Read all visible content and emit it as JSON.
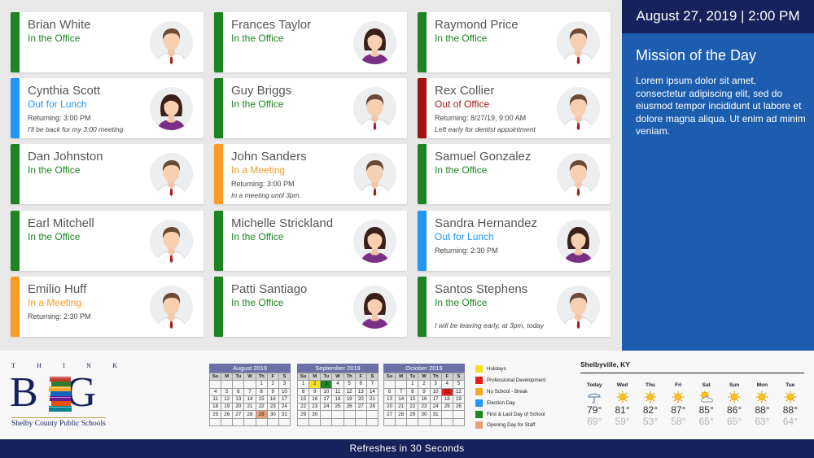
{
  "colors": {
    "in": "#1e8421",
    "lunch": "#2196f3",
    "meeting": "#fc9a28",
    "out": "#a01415",
    "navy": "#16225b",
    "panel": "#1c5daf"
  },
  "staff": [
    {
      "name": "Brian White",
      "status": "In the Office",
      "kind": "in",
      "gender": "m",
      "returning": "",
      "note": ""
    },
    {
      "name": "Cynthia Scott",
      "status": "Out for Lunch",
      "kind": "lunch",
      "gender": "f",
      "returning": "Returning: 3:00 PM",
      "note": "I'll be back for my 3:00 meeting"
    },
    {
      "name": "Dan Johnston",
      "status": "In the Office",
      "kind": "in",
      "gender": "m",
      "returning": "",
      "note": ""
    },
    {
      "name": "Earl Mitchell",
      "status": "In the Office",
      "kind": "in",
      "gender": "m",
      "returning": "",
      "note": ""
    },
    {
      "name": "Emilio Huff",
      "status": "In a Meeting",
      "kind": "meeting",
      "gender": "m",
      "returning": "Returning: 2:30 PM",
      "note": ""
    },
    {
      "name": "Frances Taylor",
      "status": "In the Office",
      "kind": "in",
      "gender": "f",
      "returning": "",
      "note": ""
    },
    {
      "name": "Guy Briggs",
      "status": "In the Office",
      "kind": "in",
      "gender": "m",
      "returning": "",
      "note": ""
    },
    {
      "name": "John Sanders",
      "status": "In a Meeting",
      "kind": "meeting",
      "gender": "m",
      "returning": "Returning: 3:00 PM",
      "note": "In a meeting until 3pm."
    },
    {
      "name": "Michelle Strickland",
      "status": "In the Office",
      "kind": "in",
      "gender": "f",
      "returning": "",
      "note": ""
    },
    {
      "name": "Patti Santiago",
      "status": "In the Office",
      "kind": "in",
      "gender": "f",
      "returning": "",
      "note": ""
    },
    {
      "name": "Raymond Price",
      "status": "In the Office",
      "kind": "in",
      "gender": "m",
      "returning": "",
      "note": ""
    },
    {
      "name": "Rex Collier",
      "status": "Out of Office",
      "kind": "out",
      "gender": "m",
      "returning": "Returning:  8/27/19, 9:00 AM",
      "note": "Left early for dentist appointment"
    },
    {
      "name": "Samuel Gonzalez",
      "status": "In the Office",
      "kind": "in",
      "gender": "m",
      "returning": "",
      "note": ""
    },
    {
      "name": "Sandra Hernandez",
      "status": "Out for Lunch",
      "kind": "lunch",
      "gender": "f",
      "returning": "Returning: 2:30 PM",
      "note": ""
    },
    {
      "name": "Santos Stephens",
      "status": "In the Office",
      "kind": "in",
      "gender": "m",
      "returning": "",
      "note": "I will be leaving early, at 3pm, today"
    }
  ],
  "header": {
    "datetime": "August 27, 2019 | 2:00 PM"
  },
  "mission": {
    "title": "Mission of the Day",
    "text": "Lorem ipsum dolor sit amet, consectetur adipiscing elit, sed do eiusmod tempor incididunt ut labore et dolore magna aliqua. Ut enim ad minim veniam."
  },
  "logo": {
    "think": [
      "T",
      "H",
      "I",
      "N",
      "K"
    ],
    "big_left": "B",
    "big_right": "G",
    "district": "Shelby County Public Schools"
  },
  "calendars": [
    {
      "title": "August 2019",
      "headers": [
        "Su",
        "M",
        "Tu",
        "W",
        "Th",
        "F",
        "S"
      ],
      "weeks": [
        [
          "",
          "",
          "",
          "",
          "1",
          "2",
          "3"
        ],
        [
          "4",
          "5",
          "6",
          "7",
          "8",
          "9",
          "10"
        ],
        [
          "11",
          "12",
          "13",
          "14",
          "15",
          "16",
          "17"
        ],
        [
          "18",
          "19",
          "20",
          "21",
          "22",
          "23",
          "24"
        ],
        [
          "25",
          "26",
          "27",
          "28",
          "29",
          "30",
          "31"
        ],
        [
          "",
          "",
          "",
          "",
          "",
          "",
          ""
        ]
      ],
      "highlights": [
        {
          "day": "29",
          "event": "Opening Day for Staff"
        }
      ]
    },
    {
      "title": "September 2019",
      "headers": [
        "Su",
        "M",
        "Tu",
        "W",
        "Th",
        "F",
        "S"
      ],
      "weeks": [
        [
          "1",
          "2",
          "3",
          "4",
          "5",
          "6",
          "7"
        ],
        [
          "8",
          "9",
          "10",
          "11",
          "12",
          "13",
          "14"
        ],
        [
          "15",
          "16",
          "17",
          "18",
          "19",
          "20",
          "21"
        ],
        [
          "22",
          "23",
          "24",
          "25",
          "26",
          "27",
          "28"
        ],
        [
          "29",
          "30",
          "",
          "",
          "",
          "",
          ""
        ],
        [
          "",
          "",
          "",
          "",
          "",
          "",
          ""
        ]
      ],
      "highlights": [
        {
          "day": "2",
          "event": "Holidays"
        },
        {
          "day": "3",
          "event": "First & Last Day of School"
        }
      ]
    },
    {
      "title": "October 2019",
      "headers": [
        "Su",
        "M",
        "Tu",
        "W",
        "Th",
        "F",
        "S"
      ],
      "weeks": [
        [
          "",
          "",
          "1",
          "2",
          "3",
          "4",
          "5"
        ],
        [
          "6",
          "7",
          "8",
          "9",
          "10",
          "11",
          "12"
        ],
        [
          "13",
          "14",
          "15",
          "16",
          "17",
          "18",
          "19"
        ],
        [
          "20",
          "21",
          "22",
          "23",
          "24",
          "25",
          "26"
        ],
        [
          "27",
          "28",
          "29",
          "30",
          "31",
          "",
          ""
        ],
        [
          "",
          "",
          "",
          "",
          "",
          "",
          ""
        ]
      ],
      "highlights": [
        {
          "day": "11",
          "event": "Professional Development"
        }
      ]
    }
  ],
  "legend": [
    {
      "label": "Holidays",
      "color": "#f5e21b"
    },
    {
      "label": "Professional Development",
      "color": "#e51c1c"
    },
    {
      "label": "No School - Break",
      "color": "#f9a825"
    },
    {
      "label": "Election Day",
      "color": "#2196f3"
    },
    {
      "label": "First & Last Day of School",
      "color": "#1e8421"
    },
    {
      "label": "Opening Day for Staff",
      "color": "#e9a07a"
    }
  ],
  "weather": {
    "location": "Shelbyville, KY",
    "days": [
      {
        "day": "Today",
        "icon": "rain-icon",
        "hi": "79°",
        "lo": "69°"
      },
      {
        "day": "Wed",
        "icon": "sun-icon",
        "hi": "81°",
        "lo": "59°"
      },
      {
        "day": "Thu",
        "icon": "sun-icon",
        "hi": "82°",
        "lo": "53°"
      },
      {
        "day": "Fri",
        "icon": "sun-icon",
        "hi": "87°",
        "lo": "58°"
      },
      {
        "day": "Sat",
        "icon": "partly-cloudy-icon",
        "hi": "85°",
        "lo": "65°"
      },
      {
        "day": "Sun",
        "icon": "sun-icon",
        "hi": "86°",
        "lo": "65°"
      },
      {
        "day": "Mon",
        "icon": "sun-icon",
        "hi": "88°",
        "lo": "63°"
      },
      {
        "day": "Tue",
        "icon": "sun-icon",
        "hi": "88°",
        "lo": "64°"
      }
    ]
  },
  "footer": {
    "text": "Refreshes in 30 Seconds"
  }
}
